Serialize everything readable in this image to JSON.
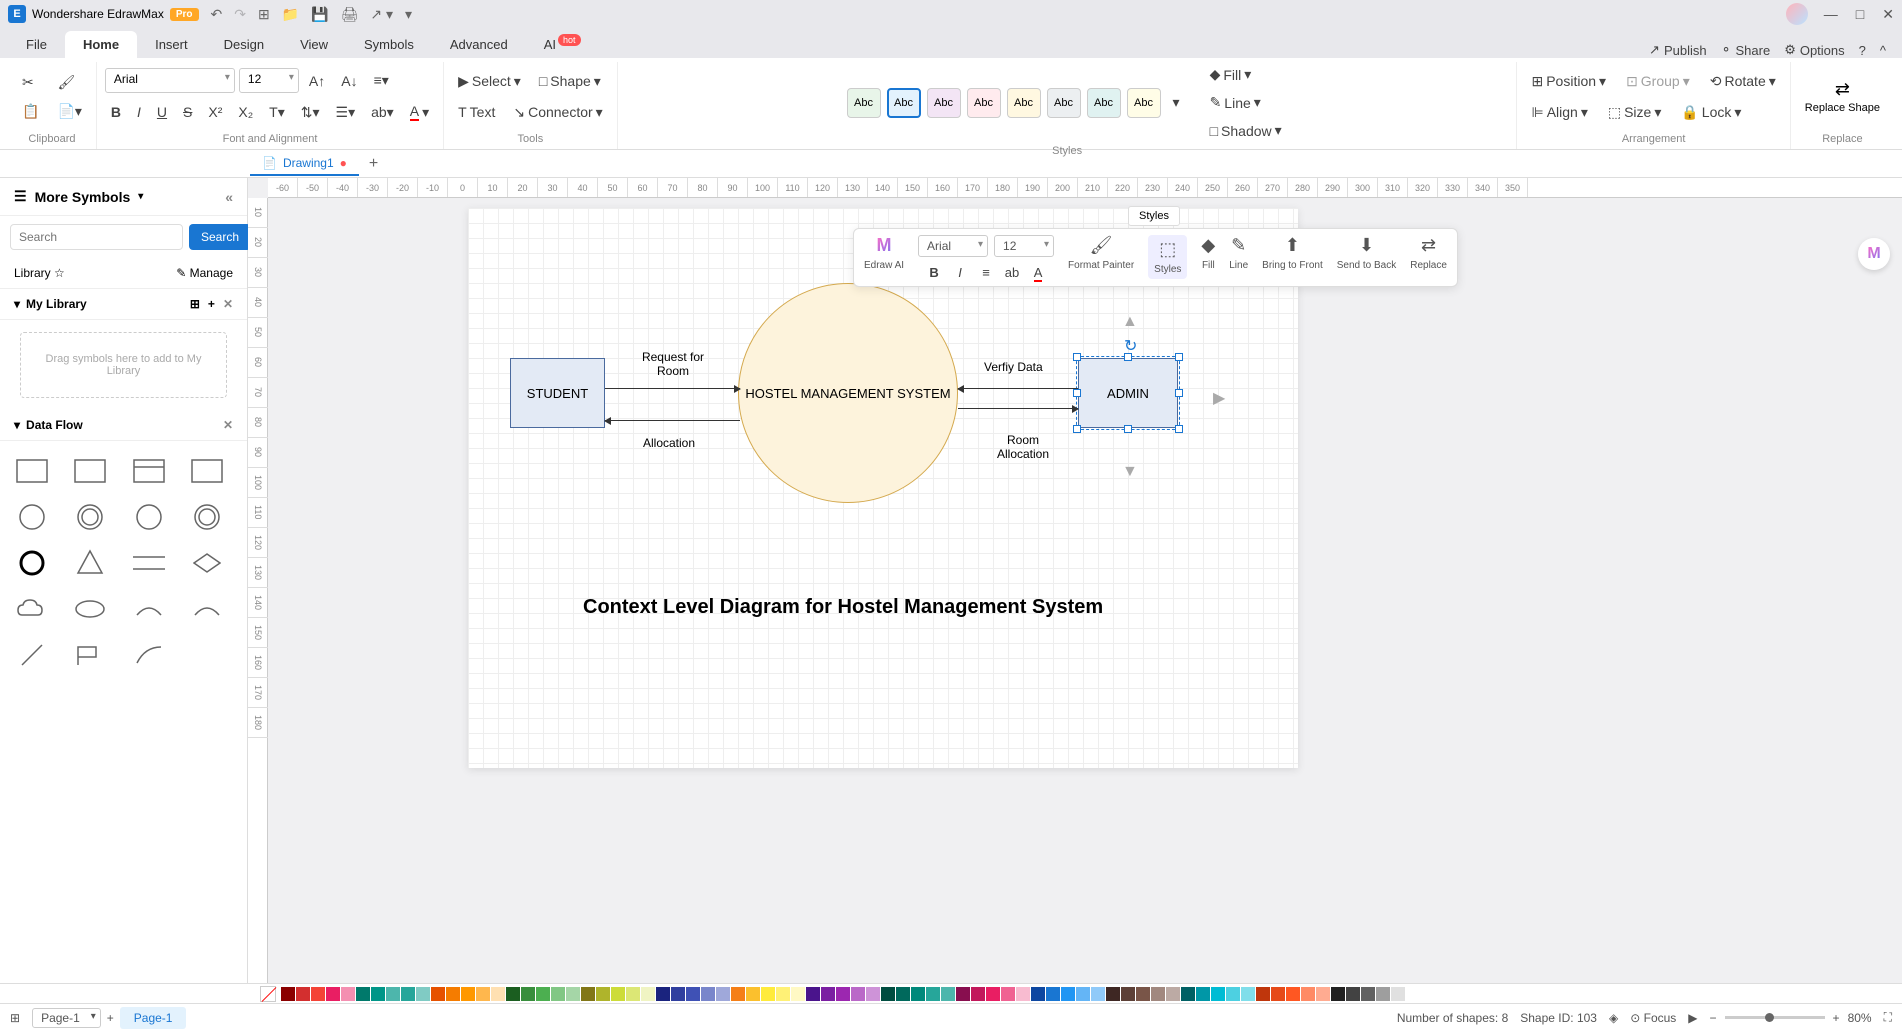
{
  "app": {
    "title": "Wondershare EdrawMax",
    "badge": "Pro"
  },
  "menu": {
    "file": "File",
    "home": "Home",
    "insert": "Insert",
    "design": "Design",
    "view": "View",
    "symbols": "Symbols",
    "advanced": "Advanced",
    "ai": "AI",
    "ai_badge": "hot",
    "publish": "Publish",
    "share": "Share",
    "options": "Options"
  },
  "ribbon": {
    "clipboard_label": "Clipboard",
    "font_label": "Font and Alignment",
    "tools_label": "Tools",
    "styles_label": "Styles",
    "arrangement_label": "Arrangement",
    "replace_label": "Replace",
    "font_family": "Arial",
    "font_size": "12",
    "select": "Select",
    "text": "Text",
    "shape": "Shape",
    "connector": "Connector",
    "style_swatch": "Abc",
    "fill": "Fill",
    "line": "Line",
    "shadow": "Shadow",
    "position": "Position",
    "align": "Align",
    "group": "Group",
    "size": "Size",
    "rotate": "Rotate",
    "lock": "Lock",
    "replace_shape": "Replace Shape"
  },
  "doc": {
    "tab_name": "Drawing1"
  },
  "sidebar": {
    "more_symbols": "More Symbols",
    "search_placeholder": "Search",
    "search_btn": "Search",
    "library_label": "Library",
    "manage": "Manage",
    "my_library": "My Library",
    "drop_hint": "Drag symbols here to add to My Library",
    "data_flow": "Data Flow"
  },
  "floating": {
    "styles_label": "Styles",
    "edraw_ai": "Edraw AI",
    "font": "Arial",
    "size": "12",
    "format_painter": "Format Painter",
    "styles": "Styles",
    "fill": "Fill",
    "line": "Line",
    "bring_front": "Bring to Front",
    "send_back": "Send to Back",
    "replace": "Replace"
  },
  "diagram": {
    "student": "STUDENT",
    "admin": "ADMIN",
    "center": "HOSTEL MANAGEMENT SYSTEM",
    "req_room": "Request for Room",
    "allocation": "Allocation",
    "verify": "Verfiy Data",
    "room_alloc": "Room Allocation",
    "title": "Context Level Diagram for Hostel Management System"
  },
  "ruler_h": [
    "-60",
    "-50",
    "-40",
    "-30",
    "-20",
    "-10",
    "0",
    "10",
    "20",
    "30",
    "40",
    "50",
    "60",
    "70",
    "80",
    "90",
    "100",
    "110",
    "120",
    "130",
    "140",
    "150",
    "160",
    "170",
    "180",
    "190",
    "200",
    "210",
    "220",
    "230",
    "240",
    "250",
    "260",
    "270",
    "280",
    "290",
    "300",
    "310",
    "320",
    "330",
    "340",
    "350"
  ],
  "ruler_v": [
    "10",
    "20",
    "30",
    "40",
    "50",
    "60",
    "70",
    "80",
    "90",
    "100",
    "110",
    "120",
    "130",
    "140",
    "150",
    "160",
    "170",
    "180"
  ],
  "status": {
    "num_shapes": "Number of shapes: 8",
    "shape_id": "Shape ID: 103",
    "focus": "Focus",
    "zoom": "80%",
    "page_sel": "Page-1",
    "page_tab": "Page-1"
  },
  "colors": [
    "#8b0000",
    "#d32f2f",
    "#f44336",
    "#e91e63",
    "#f48fb1",
    "#00796b",
    "#009688",
    "#4db6ac",
    "#26a69a",
    "#80cbc4",
    "#e65100",
    "#f57c00",
    "#ff9800",
    "#ffb74d",
    "#ffe0b2",
    "#1b5e20",
    "#388e3c",
    "#4caf50",
    "#81c784",
    "#a5d6a7",
    "#827717",
    "#afb42b",
    "#cddc39",
    "#dce775",
    "#f0f4c3",
    "#1a237e",
    "#303f9f",
    "#3f51b5",
    "#7986cb",
    "#9fa8da",
    "#f57f17",
    "#fbc02d",
    "#ffeb3b",
    "#fff176",
    "#fff9c4",
    "#4a148c",
    "#7b1fa2",
    "#9c27b0",
    "#ba68c8",
    "#ce93d8",
    "#004d40",
    "#00695c",
    "#00897b",
    "#26a69a",
    "#4db6ac",
    "#880e4f",
    "#c2185b",
    "#e91e63",
    "#f06292",
    "#f8bbd0",
    "#0d47a1",
    "#1976d2",
    "#2196f3",
    "#64b5f6",
    "#90caf9",
    "#3e2723",
    "#5d4037",
    "#795548",
    "#a1887f",
    "#bcaaa4",
    "#006064",
    "#0097a7",
    "#00bcd4",
    "#4dd0e1",
    "#80deea",
    "#bf360c",
    "#e64a19",
    "#ff5722",
    "#ff8a65",
    "#ffab91",
    "#212121",
    "#424242",
    "#616161",
    "#9e9e9e",
    "#e0e0e0"
  ]
}
